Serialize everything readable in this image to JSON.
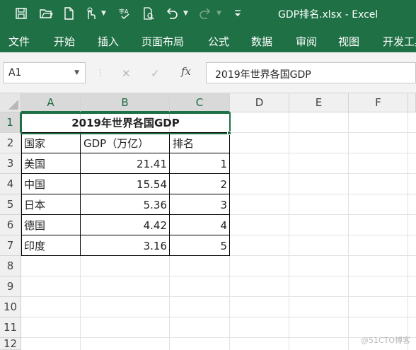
{
  "window": {
    "title": "GDP排名.xlsx  -  Excel",
    "accent": "#1f7145"
  },
  "quick_access": [
    "save-icon",
    "open-icon",
    "new-icon",
    "touch-icon",
    "spellcheck-icon",
    "print-preview-icon",
    "undo-icon",
    "redo-icon",
    "customize-icon"
  ],
  "ribbon": {
    "tabs": [
      "文件",
      "开始",
      "插入",
      "页面布局",
      "公式",
      "数据",
      "审阅",
      "视图",
      "开发工具"
    ]
  },
  "formula_bar": {
    "name_box": "A1",
    "fx": "fx",
    "formula": "2019年世界各国GDP"
  },
  "columns": [
    "A",
    "B",
    "C",
    "D",
    "E",
    "F"
  ],
  "rows": [
    "1",
    "2",
    "3",
    "4",
    "5",
    "6",
    "7",
    "8",
    "9",
    "10",
    "11",
    "12"
  ],
  "sheet": {
    "title": "2019年世界各国GDP",
    "headers": [
      "国家",
      "GDP（万亿）",
      "排名"
    ],
    "data": [
      [
        "美国",
        "21.41",
        "1"
      ],
      [
        "中国",
        "15.54",
        "2"
      ],
      [
        "日本",
        "5.36",
        "3"
      ],
      [
        "德国",
        "4.42",
        "4"
      ],
      [
        "印度",
        "3.16",
        "5"
      ]
    ]
  },
  "watermark": "@51CTO博客"
}
